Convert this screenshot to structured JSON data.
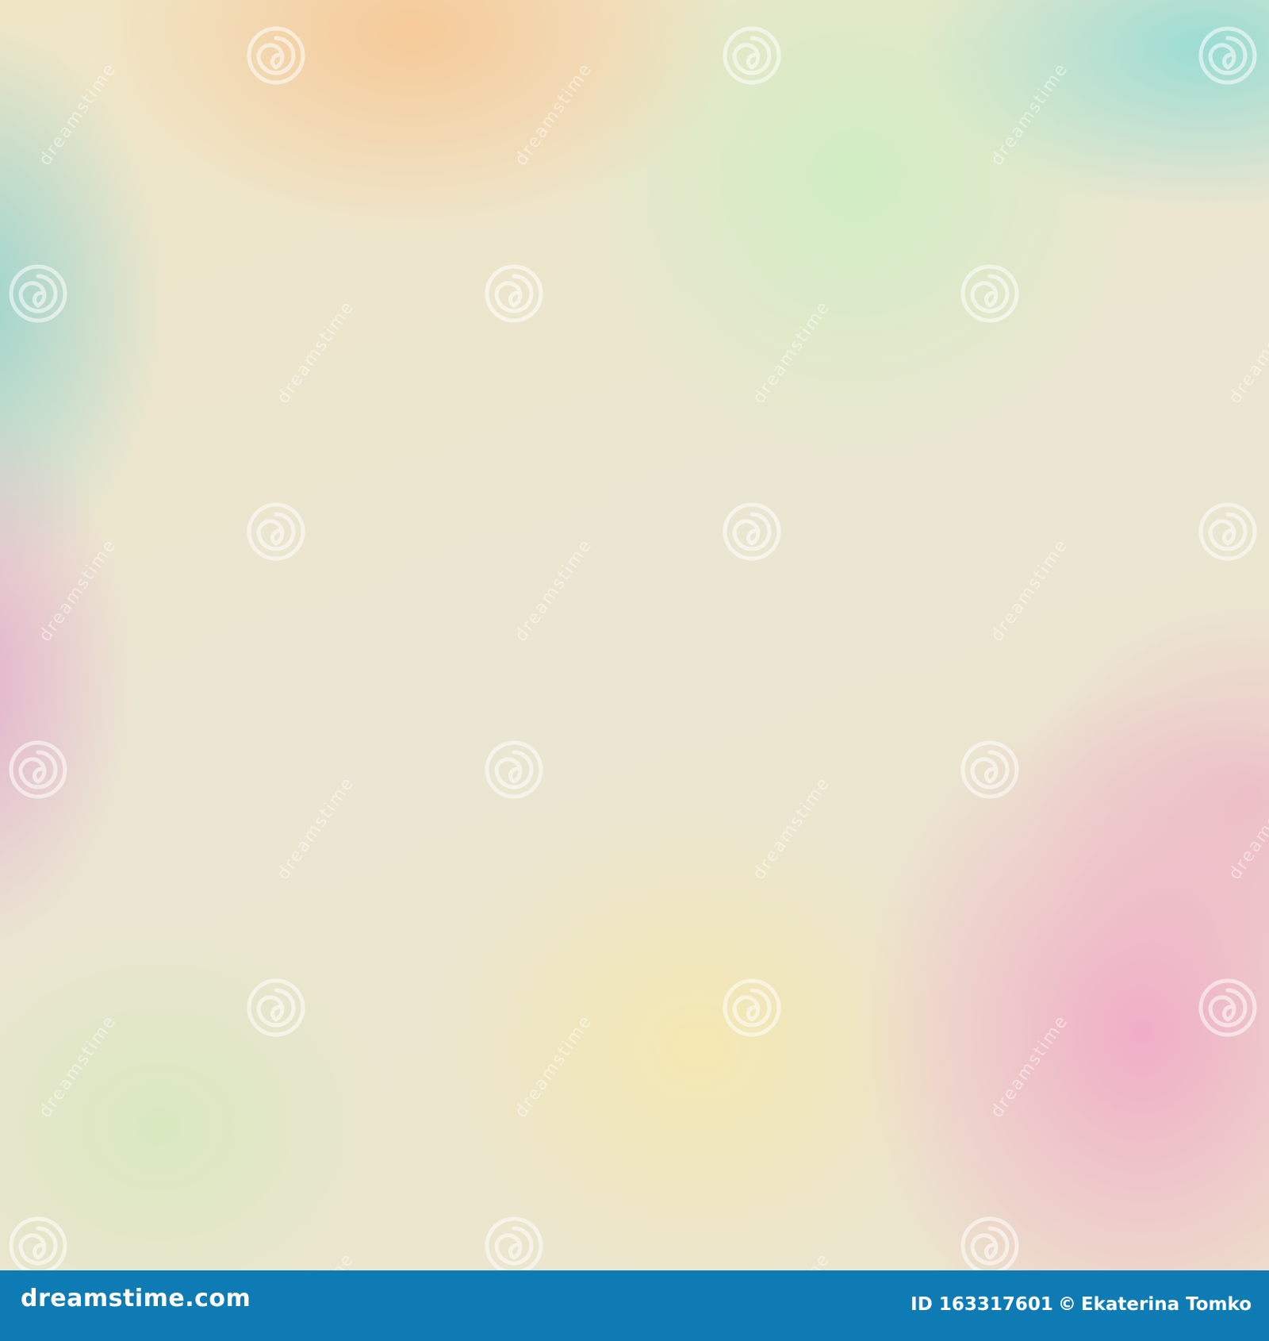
{
  "image": {
    "description_colors": {
      "footer_bar": "#0e7bb4",
      "top_teal": "#96dcd4",
      "top_orange": "#f6c896",
      "top_green": "#cdeec3",
      "left_teal": "#96d2cd",
      "left_pink": "#e1aacd",
      "right_pink": "#f0aac6",
      "bottom_yellow": "#f5e8af",
      "center_cream": "#ebe6d2"
    }
  },
  "watermark": {
    "text": "dreamstime",
    "icon": "spiral-logo-icon"
  },
  "footer": {
    "logo_text": "dreamstime.com",
    "id_label": "ID 163317601",
    "copyright_symbol": "©",
    "author": "Ekaterina Tomko"
  }
}
